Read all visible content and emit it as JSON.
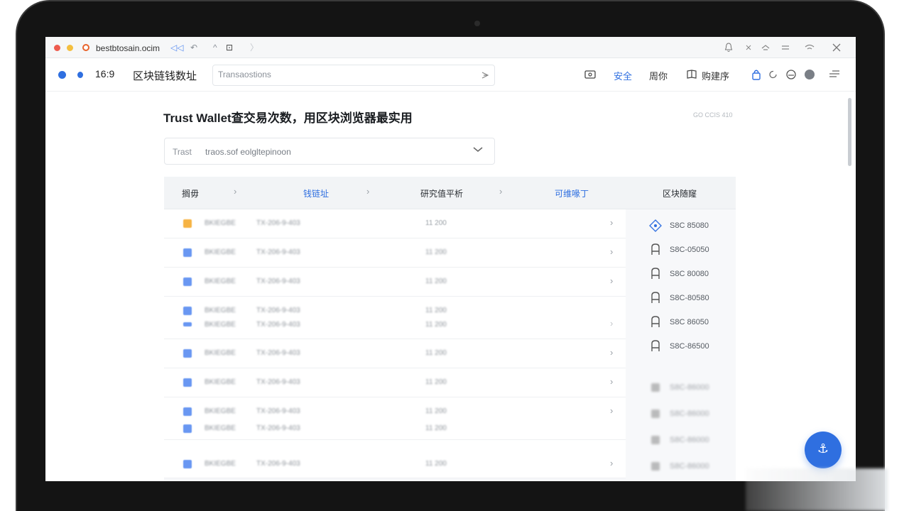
{
  "browser": {
    "url": "bestbtosain.ocim",
    "controls": [
      "◁◁",
      "↶",
      "^",
      "⊡",
      "〉"
    ],
    "right_icons": [
      "bell-icon",
      "close-small-icon",
      "cast-icon",
      "minimize-icon",
      "wifi-icon",
      "close-icon"
    ]
  },
  "header": {
    "ratio": "16:9",
    "title": "区块链钱数址",
    "search_placeholder": "Transaostions",
    "nav": [
      {
        "label": "安全",
        "active": true
      },
      {
        "label": "周你",
        "active": false
      },
      {
        "label": "购建序",
        "active": false
      }
    ]
  },
  "main": {
    "title": "Trust Wallet查交易次数，用区块浏览器最实用",
    "code": "GO CCIS 410",
    "select": {
      "prefix": "Trast",
      "value": "traos.sof eolgltepinoon"
    }
  },
  "table": {
    "headers": [
      "搁毋",
      "钱链址",
      "研究值平析",
      "可维喙丁",
      "区块随窿"
    ],
    "rows": [
      {
        "name": "BKIEGBE",
        "hash": "TX-206-9-403",
        "value": "11 200",
        "color": "orange"
      },
      {
        "name": "BKIEGBE",
        "hash": "TX-206-9-403",
        "value": "11 200",
        "color": "blue"
      },
      {
        "name": "BKIEGBE",
        "hash": "TX-206-9-403",
        "value": "11 200",
        "color": "blue"
      },
      {
        "name": "BKIEGBE",
        "hash": "TX-206-9-403",
        "value": "11 200",
        "color": "blue"
      },
      {
        "name": "BKIEGBE",
        "hash": "TX-206-9-403",
        "value": "11 200",
        "color": "blue"
      },
      {
        "name": "BKIEGBE",
        "hash": "TX-206-9-403",
        "value": "11 200",
        "color": "blue"
      },
      {
        "name": "BKIEGBE",
        "hash": "TX-206-9-403",
        "value": "11 200",
        "color": "blue"
      },
      {
        "name": "BKIEGBE",
        "hash": "TX-206-9-403",
        "value": "11 200",
        "color": "blue"
      }
    ],
    "sub_rows": [
      {
        "name": "BKIEGBE",
        "hash": "TX-206-9-403",
        "value": "11 200"
      },
      {
        "name": "BKIEGBE",
        "hash": "TX-206-9-403",
        "value": "11 200"
      }
    ]
  },
  "side_list": [
    {
      "label": "S8C 85080",
      "icon": "diamond-icon"
    },
    {
      "label": "S8C-05050",
      "icon": "chair-icon"
    },
    {
      "label": "S8C 80080",
      "icon": "chair-icon"
    },
    {
      "label": "S8C-80580",
      "icon": "chair-icon"
    },
    {
      "label": "S8C 86050",
      "icon": "chair-icon"
    },
    {
      "label": "S8C-86500",
      "icon": "chair-icon"
    },
    {
      "label": "S8C-86000",
      "icon": "square-icon"
    },
    {
      "label": "S8C-86000",
      "icon": "square-icon"
    },
    {
      "label": "S8C-86000",
      "icon": "square-icon"
    },
    {
      "label": "S8C-86000",
      "icon": "square-icon"
    }
  ],
  "fab_icon": "anchor-icon",
  "colors": {
    "accent": "#2f6fe0",
    "warning": "#f5a623",
    "bezel": "#141414"
  }
}
